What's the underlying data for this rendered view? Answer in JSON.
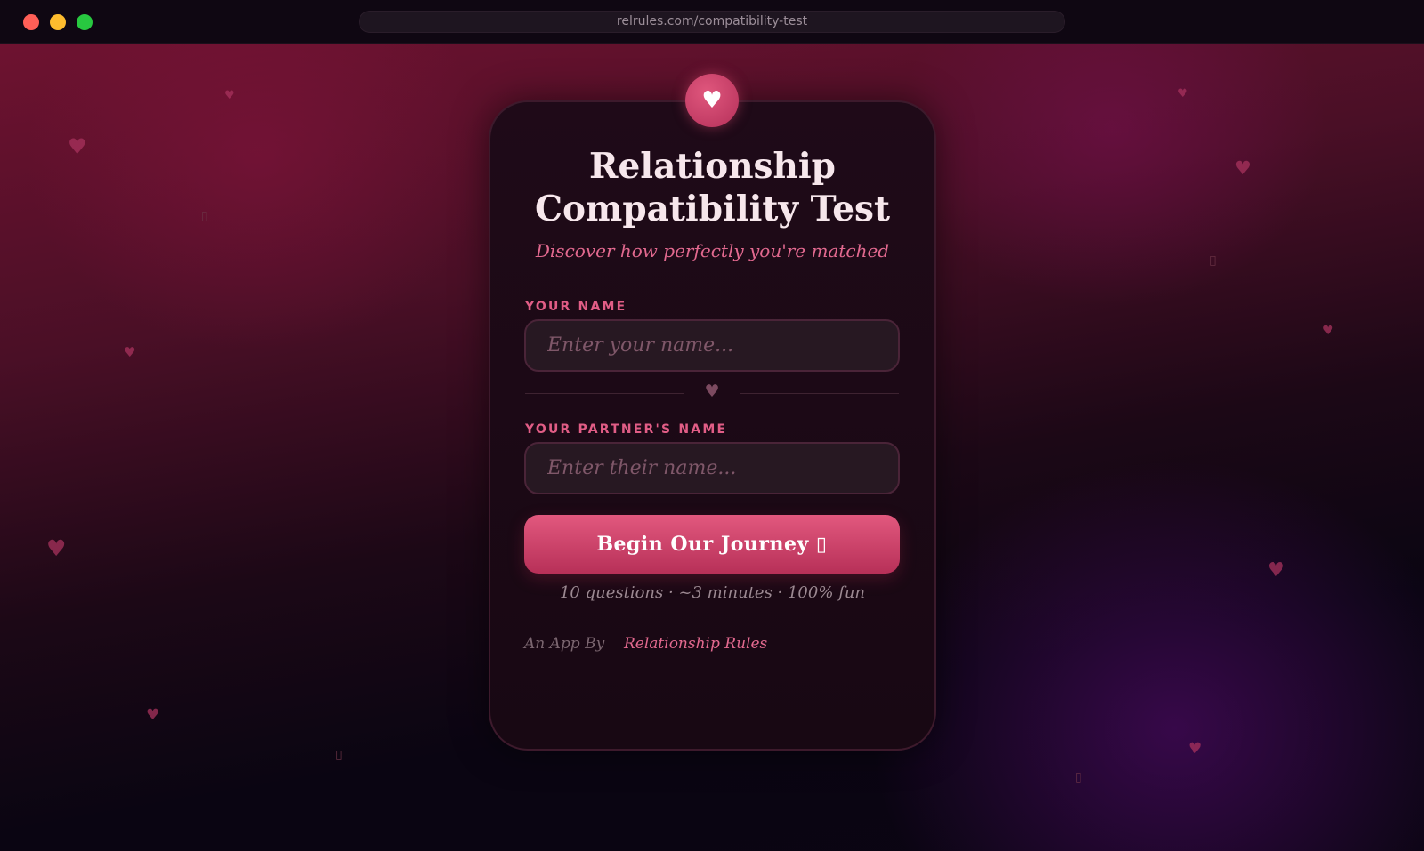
{
  "browser": {
    "url": "relrules.com/compatibility-test"
  },
  "card": {
    "badge_icon": "heart-icon",
    "badge_glyph": "♥",
    "title": "Relationship Compatibility Test",
    "subtitle": "Discover how perfectly you're matched",
    "your_name": {
      "label": "YOUR NAME",
      "placeholder": "Enter your name...",
      "value": ""
    },
    "divider_glyph": "♥",
    "partner_name": {
      "label": "YOUR PARTNER'S NAME",
      "placeholder": "Enter their name...",
      "value": ""
    },
    "cta_label": "Begin Our Journey ▯",
    "meta": "10 questions · ~3 minutes · 100% fun",
    "byline": "An App By",
    "brand_link": "Relationship Rules"
  },
  "background": {
    "heart_glyph": "♥",
    "box_glyph": "▯"
  },
  "colors": {
    "accent": "#e15d86",
    "button_top": "#e2587e",
    "button_bottom": "#b73058",
    "card_bg": "#1c0915",
    "title_text": "#f7e7ec"
  }
}
